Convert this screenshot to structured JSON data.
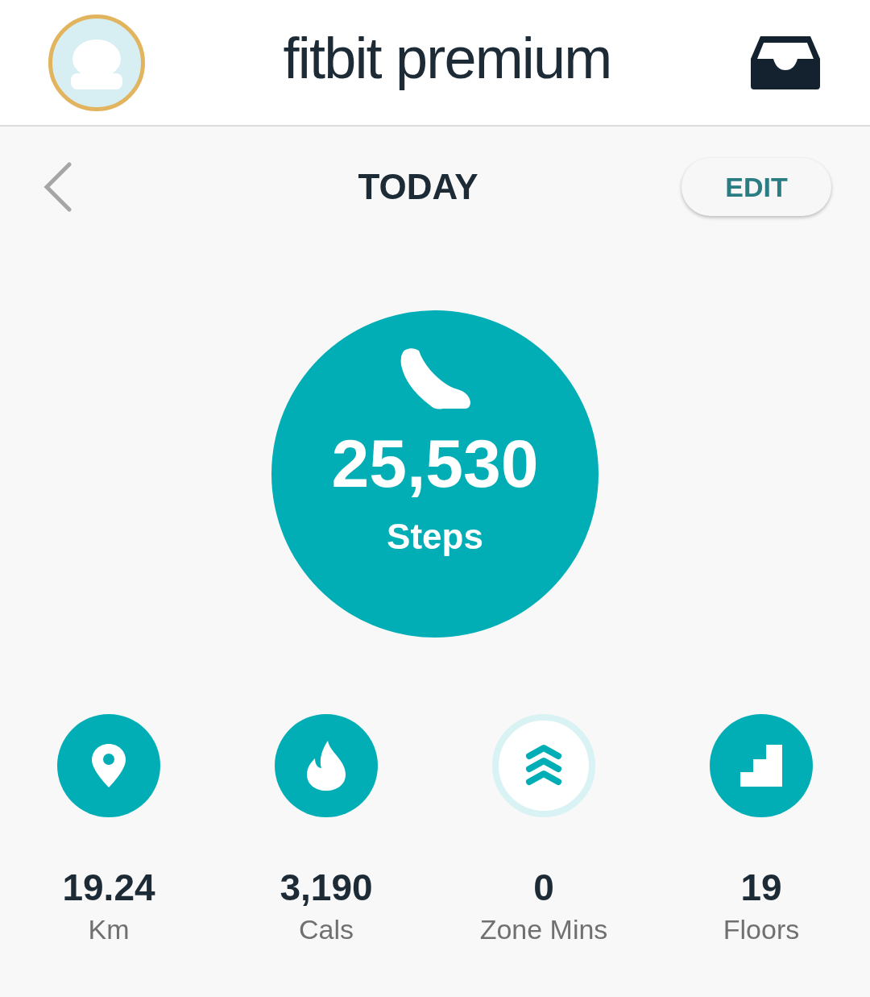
{
  "header": {
    "title": "fitbit premium"
  },
  "nav": {
    "title": "TODAY",
    "edit_button": "EDIT"
  },
  "steps": {
    "value": "25,530",
    "label": "Steps"
  },
  "stats": [
    {
      "kind": "distance",
      "value": "19.24",
      "unit": "Km",
      "filled": true
    },
    {
      "kind": "calories",
      "value": "3,190",
      "unit": "Cals",
      "filled": true
    },
    {
      "kind": "zone",
      "value": "0",
      "unit": "Zone Mins",
      "filled": false
    },
    {
      "kind": "floors",
      "value": "19",
      "unit": "Floors",
      "filled": true
    }
  ]
}
